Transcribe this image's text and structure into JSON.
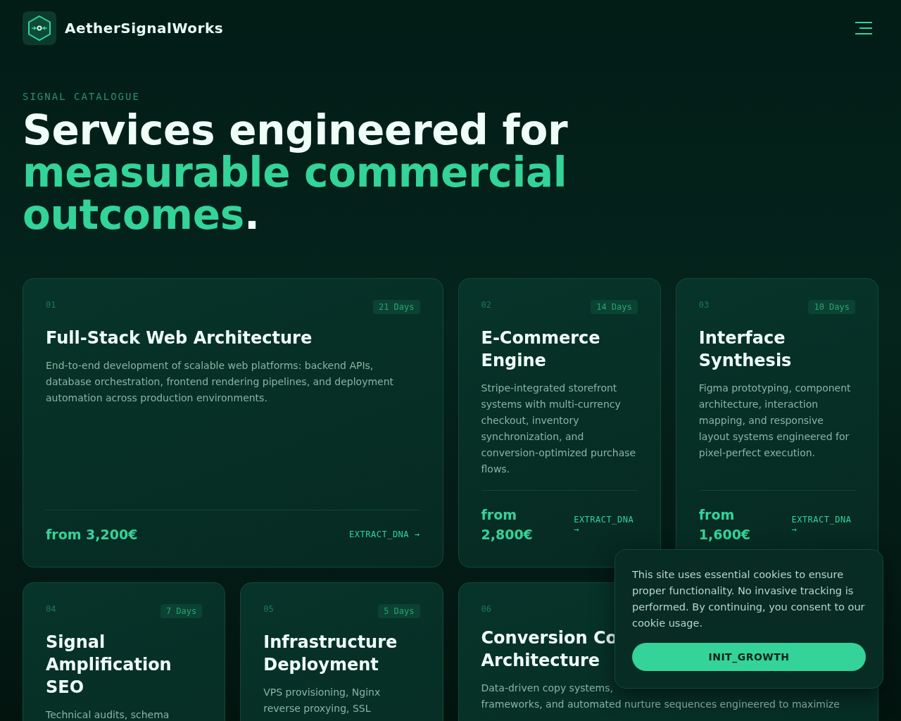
{
  "brand": {
    "name": "AetherSignalWorks"
  },
  "hero": {
    "eyebrow": "SIGNAL CATALOGUE",
    "heading_lead": "Services engineered for",
    "heading_accent": "measurable commercial outcomes",
    "heading_tail": "."
  },
  "services": [
    {
      "kind": "wide",
      "number": "01",
      "duration": "21 Days",
      "title": "Full-Stack Web Architecture",
      "description": "End-to-end development of scalable web platforms: backend APIs, database orchestration, frontend rendering pipelines, and deployment automation across production environments.",
      "price": "from 3,200€",
      "link": "EXTRACT_DNA →"
    },
    {
      "kind": "narrow",
      "number": "02",
      "duration": "14 Days",
      "title": "E-Commerce Engine",
      "description": "Stripe-integrated storefront systems with multi-currency checkout, inventory synchronization, and conversion-optimized purchase flows.",
      "price": "from 2,800€",
      "link": "EXTRACT_DNA →"
    },
    {
      "kind": "narrow",
      "number": "03",
      "duration": "10 Days",
      "title": "Interface Synthesis",
      "description": "Figma prototyping, component architecture, interaction mapping, and responsive layout systems engineered for pixel-perfect execution.",
      "price": "from 1,600€",
      "link": "EXTRACT_DNA →"
    },
    {
      "kind": "narrow",
      "number": "04",
      "duration": "7 Days",
      "title": "Signal Amplification SEO",
      "description": "Technical audits, schema"
    },
    {
      "kind": "narrow",
      "number": "05",
      "duration": "5 Days",
      "title": "Infrastructure Deployment",
      "description": "VPS provisioning, Nginx reverse proxying, SSL"
    },
    {
      "kind": "wide",
      "number": "06",
      "title": "Conversion Co\nArchitecture",
      "description": "Data-driven copy systems,\nframeworks, and automated nurture sequences engineered to maximize"
    }
  ],
  "cookie_banner": {
    "message": "This site uses essential cookies to ensure proper functionality. No invasive tracking is performed. By continuing, you consent to our cookie usage.",
    "button": "INIT_GROWTH"
  }
}
